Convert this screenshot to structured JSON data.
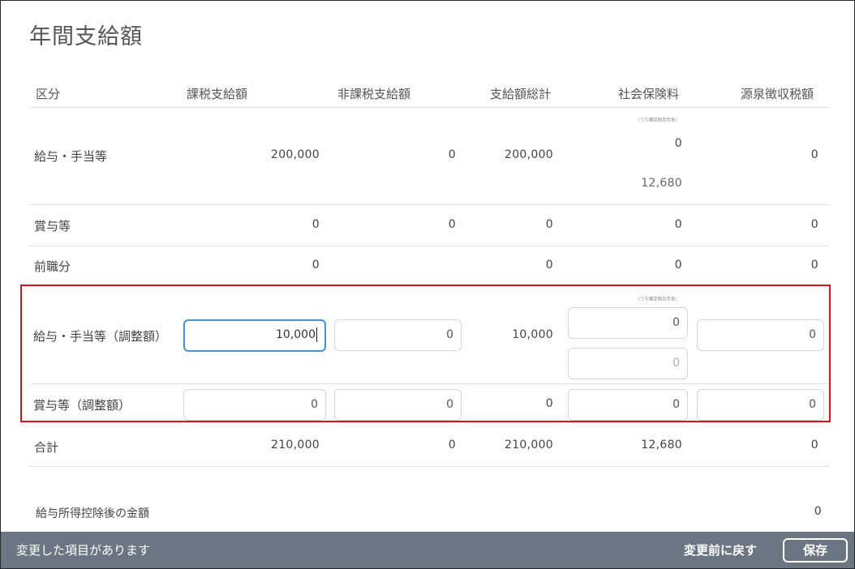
{
  "title": "年間支給額",
  "headers": {
    "category": "区分",
    "taxable": "課税支給額",
    "nontaxable": "非課税支給額",
    "total": "支給額総計",
    "social": "社会保険料",
    "withholding": "源泉徴収税額"
  },
  "rows": {
    "salary": {
      "label": "給与・手当等",
      "taxable": "200,000",
      "nontaxable": "0",
      "total": "200,000",
      "social_note": "(うち確定拠出年金)",
      "social_dc": "0",
      "social": "12,680",
      "withholding": "0"
    },
    "bonus": {
      "label": "賞与等",
      "taxable": "0",
      "nontaxable": "0",
      "total": "0",
      "social": "0",
      "withholding": "0"
    },
    "previous": {
      "label": "前職分",
      "taxable": "0",
      "total": "0",
      "social": "0",
      "withholding": "0"
    },
    "salary_adj": {
      "label": "給与・手当等（調整額）",
      "taxable": "10,000",
      "nontaxable": "0",
      "total": "10,000",
      "social_note": "(うち確定拠出年金)",
      "social_dc": "0",
      "social": "0",
      "withholding": "0"
    },
    "bonus_adj": {
      "label": "賞与等（調整額）",
      "taxable": "0",
      "nontaxable": "0",
      "total": "0",
      "social": "0",
      "withholding": "0"
    },
    "sum": {
      "label": "合計",
      "taxable": "210,000",
      "nontaxable": "0",
      "total": "210,000",
      "social": "12,680",
      "withholding": "0"
    }
  },
  "after_deduction": {
    "label": "給与所得控除後の金額",
    "value": "0"
  },
  "footer": {
    "message": "変更した項目があります",
    "revert_label": "変更前に戻す",
    "save_label": "保存"
  },
  "colors": {
    "highlight_border": "#e0111a",
    "footer_bg": "#6b7682",
    "focus_border": "#4a90d9"
  }
}
